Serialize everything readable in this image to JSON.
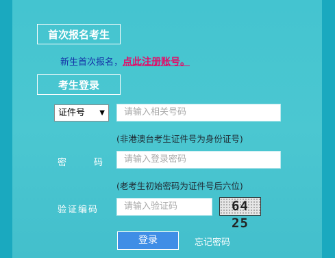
{
  "new_student": {
    "title": "首次报名考生",
    "text": "新生首次报名，",
    "register_link": "点此注册账号。"
  },
  "login": {
    "title": "考生登录",
    "id_type_selected": "证件号",
    "id_placeholder": "请输入相关号码",
    "id_hint": "(非港澳台考生证件号为身份证号)",
    "password_label_1": "密",
    "password_label_2": "码",
    "password_placeholder": "请输入登录密码",
    "password_hint": "(老考生初始密码为证件号后六位)",
    "captcha_label": "验证编码",
    "captcha_placeholder": "请输入验证码",
    "captcha_image_text": "64 25",
    "login_button": "登录",
    "forgot_link": "忘记密码"
  },
  "colors": {
    "background": "#4bc7d1",
    "link_accent": "#e0106a",
    "button": "#3f8ee6"
  }
}
